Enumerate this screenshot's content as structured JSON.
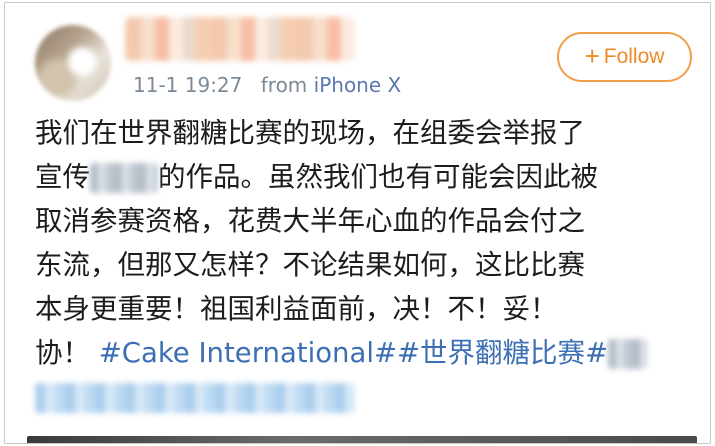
{
  "header": {
    "timestamp": "11-1 19:27",
    "from_label": "from",
    "device": "iPhone X",
    "follow_label": "Follow",
    "follow_icon": "plus-icon"
  },
  "post": {
    "line1": "我们在世界翻糖比赛的现场，在组委会举报了",
    "line2_start": "宣传",
    "line2_end": "的作品。虽然我们也有可能会因此被",
    "line3": "取消参赛资格，花费大半年心血的作品会付之",
    "line4": "东流，但那又怎样？不论结果如何，这比比赛",
    "line5": "本身更重要！祖国利益面前，决！不！妥！",
    "line6_start": "协！",
    "hashtags": "#Cake International##世界翻糖比赛#"
  },
  "colors": {
    "accent": "#ef8a2a",
    "link": "#3c6fb4",
    "meta": "#7b8a98"
  }
}
